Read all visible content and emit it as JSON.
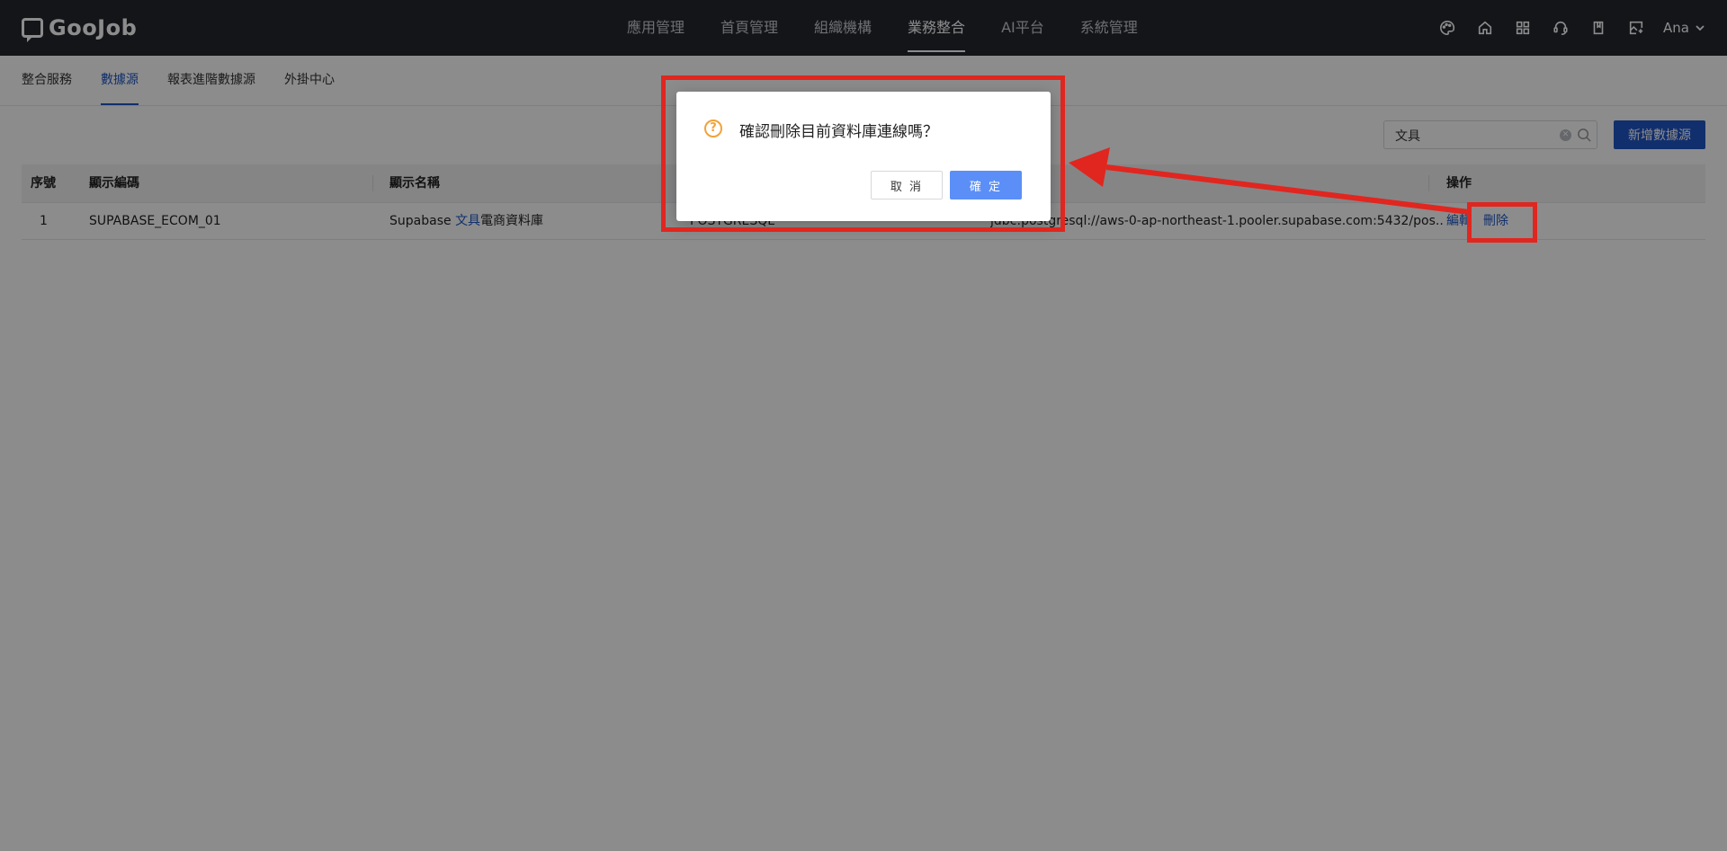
{
  "app": {
    "logo_text": "GooJob"
  },
  "topnav": {
    "items": [
      {
        "label": "應用管理"
      },
      {
        "label": "首頁管理"
      },
      {
        "label": "組織機構"
      },
      {
        "label": "業務整合",
        "active": true
      },
      {
        "label": "AI平台"
      },
      {
        "label": "系統管理"
      }
    ],
    "icons": [
      "palette-icon",
      "home-icon",
      "apps-grid-icon",
      "support-headset-icon",
      "book-icon",
      "image-edit-icon"
    ],
    "user": "Ana"
  },
  "subtabs": [
    {
      "label": "整合服務"
    },
    {
      "label": "數據源",
      "active": true
    },
    {
      "label": "報表進階數據源"
    },
    {
      "label": "外掛中心"
    }
  ],
  "toolbar": {
    "search_value": "文具",
    "add_label": "新增數據源"
  },
  "table": {
    "headers": [
      "序號",
      "顯示編碼",
      "顯示名稱",
      "操作"
    ],
    "rows": [
      {
        "index": "1",
        "code": "SUPABASE_ECOM_01",
        "name_prefix": "Supabase ",
        "name_highlight": "文具",
        "name_suffix": "電商資料庫",
        "type": "POSTGRESQL",
        "url": "jdbc:postgresql://aws-0-ap-northeast-1.pooler.supabase.com:5432/pos...",
        "edit_label": "編輯",
        "delete_label": "刪除"
      }
    ]
  },
  "dialog": {
    "message": "確認刪除目前資料庫連線嗎？",
    "cancel_label": "取 消",
    "ok_label": "確 定"
  },
  "colors": {
    "accent": "#1f57c3",
    "primary_button": "#2256c7",
    "confirm_button": "#5b8ff7",
    "warning_icon": "#f2a23a",
    "annotation_red": "#e0261f",
    "topbar_bg": "#23272f"
  }
}
